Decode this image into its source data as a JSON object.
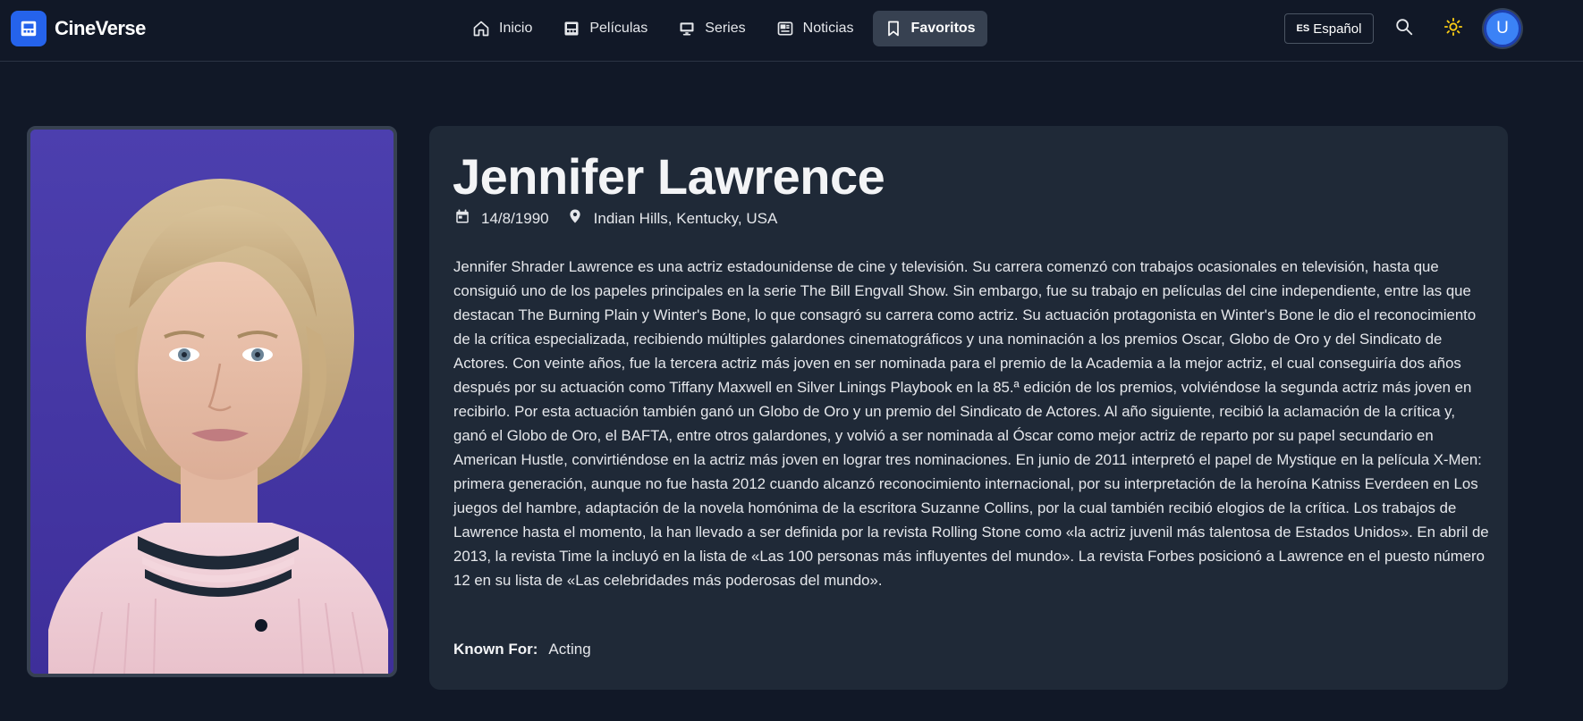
{
  "app": {
    "name": "CineVerse"
  },
  "nav": {
    "items": [
      {
        "label": "Inicio",
        "icon": "home-icon",
        "active": false
      },
      {
        "label": "Películas",
        "icon": "film-icon",
        "active": false
      },
      {
        "label": "Series",
        "icon": "tv-icon",
        "active": false
      },
      {
        "label": "Noticias",
        "icon": "newspaper-icon",
        "active": false
      },
      {
        "label": "Favoritos",
        "icon": "bookmark-icon",
        "active": true
      }
    ]
  },
  "header": {
    "language_code": "ES",
    "language_label": "Español",
    "user_initial": "U"
  },
  "person": {
    "name": "Jennifer Lawrence",
    "birthday": "14/8/1990",
    "birthplace": "Indian Hills, Kentucky, USA",
    "biography": "Jennifer Shrader Lawrence es una actriz estadounidense de cine y televisión. Su carrera comenzó con trabajos ocasionales en televisión, hasta que consiguió uno de los papeles principales en la serie The Bill Engvall Show. Sin embargo, fue su trabajo en películas del cine independiente, entre las que destacan The Burning Plain y Winter's Bone, lo que consagró su carrera como actriz. Su actuación protagonista en Winter's Bone le dio el reconocimiento de la crítica especializada, recibiendo múltiples galardones cinematográficos y una nominación a los premios Oscar, Globo de Oro y del Sindicato de Actores. Con veinte años, fue la tercera actriz más joven en ser nominada para el premio de la Academia a la mejor actriz, el cual conseguiría dos años después por su actuación como Tiffany Maxwell en Silver Linings Playbook en la 85.ª edición de los premios, volviéndose la segunda actriz más joven en recibirlo. Por esta actuación también ganó un Globo de Oro y un premio del Sindicato de Actores. Al año siguiente, recibió la aclamación de la crítica y, ganó el Globo de Oro, el BAFTA, entre otros galardones, y volvió a ser nominada al Óscar como mejor actriz de reparto por su papel secundario en American Hustle, convirtiéndose en la actriz más joven en lograr tres nominaciones. En junio de 2011 interpretó el papel de Mystique en la película X-Men: primera generación, aunque no fue hasta 2012 cuando alcanzó reconocimiento internacional, por su interpretación de la heroína Katniss Everdeen en Los juegos del hambre, adaptación de la novela homónima de la escritora Suzanne Collins, por la cual también recibió elogios de la crítica. Los trabajos de Lawrence hasta el momento, la han llevado a ser definida por la revista Rolling Stone como «la actriz juvenil más talentosa de Estados Unidos». En abril de 2013, la revista Time la incluyó en la lista de «Las 100 personas más influyentes del mundo». La revista Forbes posicionó a Lawrence en el puesto número 12 en su lista de «Las celebridades más poderosas del mundo».",
    "known_for_label": "Known For:",
    "known_for": "Acting"
  },
  "colors": {
    "background": "#111827",
    "card": "#1f2937",
    "accent": "#2563eb",
    "active_nav": "#374151",
    "sun": "#facc15"
  }
}
